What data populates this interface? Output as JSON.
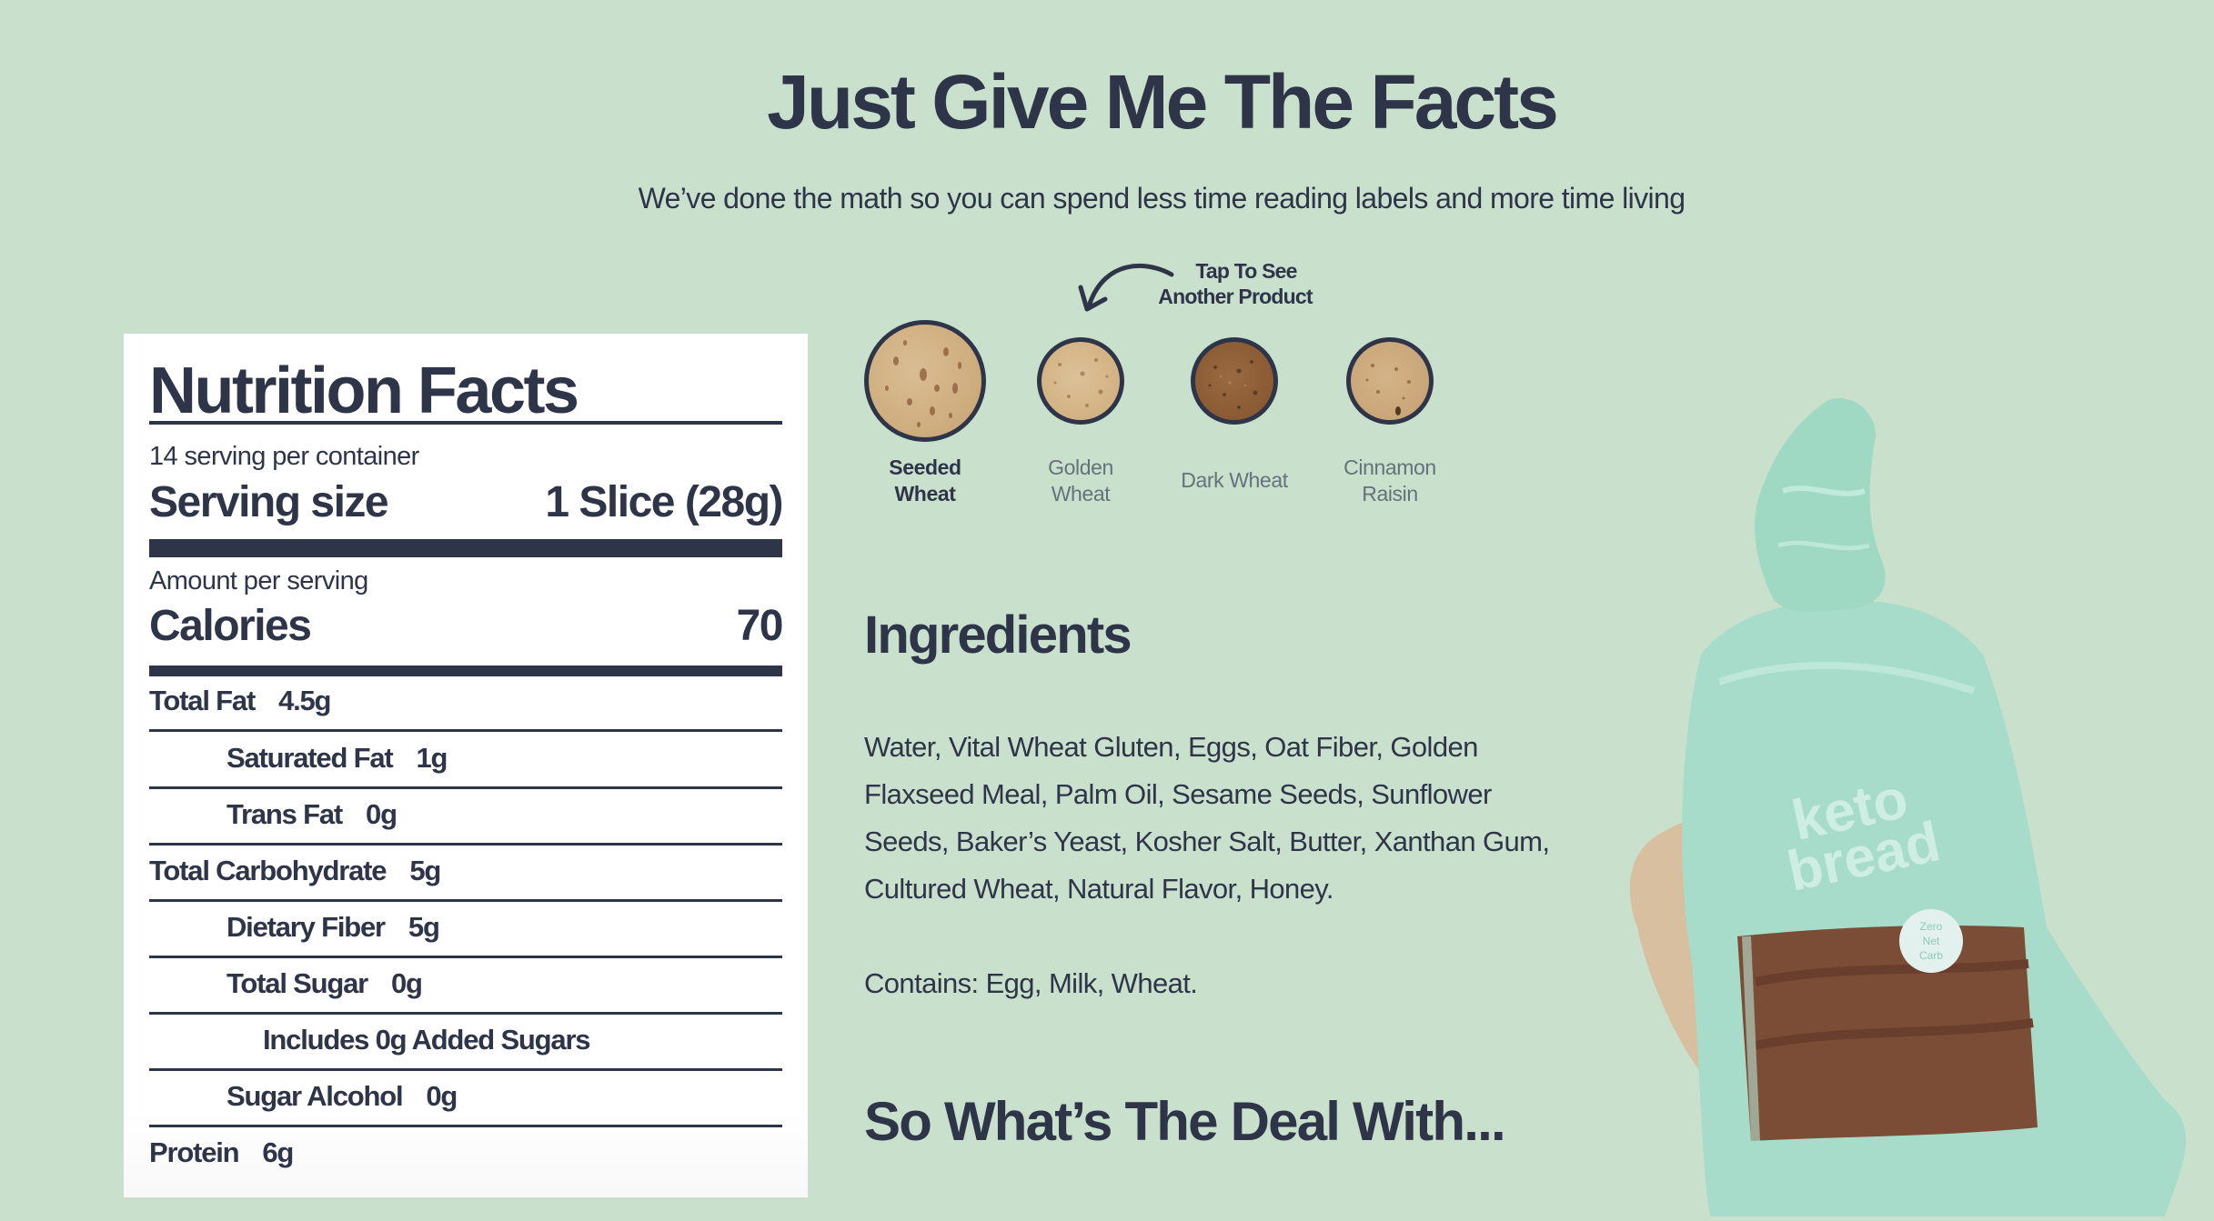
{
  "header": {
    "title": "Just Give Me The Facts",
    "subtitle": "We’ve done the math so you can spend less time reading labels and more time living"
  },
  "nutrition": {
    "title": "Nutrition Facts",
    "servings_per_container": "14 serving per container",
    "serving_size_label": "Serving size",
    "serving_size_value": "1 Slice (28g)",
    "amount_per_serving": "Amount per serving",
    "calories_label": "Calories",
    "calories_value": "70",
    "rows": [
      {
        "label": "Total Fat",
        "value": "4.5g"
      },
      {
        "label": "Saturated Fat",
        "value": "1g"
      },
      {
        "label": "Trans Fat",
        "value": "0g"
      },
      {
        "label": "Total Carbohydrate",
        "value": "5g"
      },
      {
        "label": "Dietary Fiber",
        "value": "5g"
      },
      {
        "label": "Total Sugar",
        "value": "0g"
      },
      {
        "label": "Includes 0g Added Sugars",
        "value": ""
      },
      {
        "label": "Sugar Alcohol",
        "value": "0g"
      },
      {
        "label": "Protein",
        "value": "6g"
      }
    ]
  },
  "product_selector": {
    "hint_line1": "Tap To See",
    "hint_line2": "Another Product",
    "hint_icon": "curved-arrow-icon",
    "products": [
      {
        "line1": "Seeded",
        "line2": "Wheat",
        "active": true
      },
      {
        "line1": "Golden",
        "line2": "Wheat",
        "active": false
      },
      {
        "line1": "Dark Wheat",
        "line2": "",
        "active": false
      },
      {
        "line1": "Cinnamon",
        "line2": "Raisin",
        "active": false
      }
    ]
  },
  "ingredients": {
    "title": "Ingredients",
    "body": "Water, Vital Wheat Gluten, Eggs, Oat Fiber, Golden Flaxseed Meal, Palm Oil, Sesame Seeds, Sunflower Seeds, Baker’s Yeast, Kosher Salt, Butter, Xanthan Gum, Cultured Wheat, Natural Flavor, Honey.",
    "contains": "Contains: Egg, Milk, Wheat."
  },
  "deal": {
    "title": "So What’s The Deal With..."
  },
  "product_image": {
    "brand_text": "keto bread",
    "badge_text": "Zero Net Carb"
  },
  "colors": {
    "background": "#c9e1cc",
    "text": "#2f3549",
    "inactive_label": "#66727a",
    "bag": "#a6dcc9"
  }
}
